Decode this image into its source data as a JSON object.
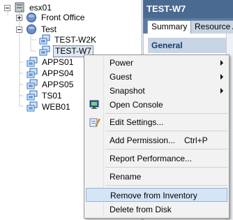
{
  "tree": {
    "root_label": "esx01",
    "nodes": [
      {
        "label": "Front Office",
        "icon": "resource-pool-icon"
      },
      {
        "label": "Test",
        "icon": "resource-pool-icon"
      },
      {
        "label": "TEST-W2K",
        "icon": "vm-icon"
      },
      {
        "label": "TEST-W7",
        "icon": "vm-icon"
      },
      {
        "label": "APPS01",
        "icon": "vm-icon"
      },
      {
        "label": "APPS04",
        "icon": "vm-icon"
      },
      {
        "label": "APPS05",
        "icon": "vm-icon"
      },
      {
        "label": "TS01",
        "icon": "vm-icon"
      },
      {
        "label": "WEB01",
        "icon": "vm-icon"
      }
    ],
    "selected": "TEST-W7"
  },
  "right_panel": {
    "title": "TEST-W7",
    "tabs": [
      "Summary",
      "Resource A"
    ],
    "active_tab": "Summary",
    "section_header": "General"
  },
  "context_menu": {
    "items": [
      {
        "label": "Power",
        "has_submenu": true
      },
      {
        "label": "Guest",
        "has_submenu": true
      },
      {
        "label": "Snapshot",
        "has_submenu": true
      },
      {
        "label": "Open Console",
        "icon": "console-icon"
      },
      {
        "label": "Edit Settings...",
        "icon": "edit-settings-icon"
      },
      {
        "label": "Add Permission...",
        "shortcut": "Ctrl+P"
      },
      {
        "label": "Report Performance..."
      },
      {
        "label": "Rename"
      },
      {
        "label": "Remove from Inventory"
      },
      {
        "label": "Delete from Disk"
      }
    ],
    "highlighted": "Remove from Inventory"
  },
  "colors": {
    "title_bar": "#4a6a92",
    "section_header_bg": "#c7d4e6",
    "menu_highlight": "#d6e5f5"
  }
}
